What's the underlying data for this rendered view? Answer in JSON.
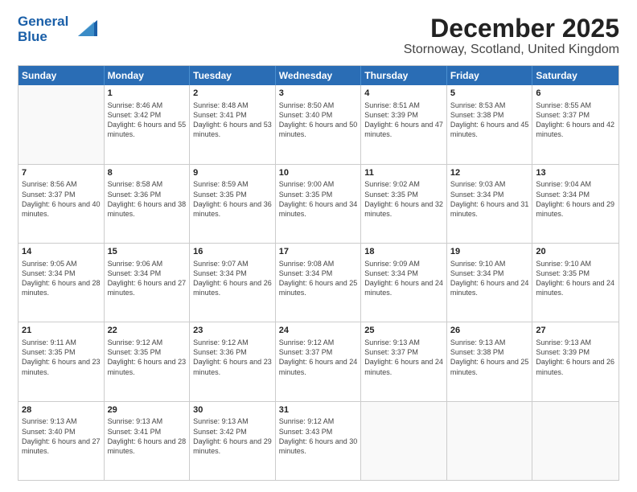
{
  "logo": {
    "line1": "General",
    "line2": "Blue"
  },
  "title": "December 2025",
  "subtitle": "Stornoway, Scotland, United Kingdom",
  "days": [
    "Sunday",
    "Monday",
    "Tuesday",
    "Wednesday",
    "Thursday",
    "Friday",
    "Saturday"
  ],
  "rows": [
    [
      {
        "day": "",
        "sunrise": "",
        "sunset": "",
        "daylight": ""
      },
      {
        "day": "1",
        "sunrise": "Sunrise: 8:46 AM",
        "sunset": "Sunset: 3:42 PM",
        "daylight": "Daylight: 6 hours and 55 minutes."
      },
      {
        "day": "2",
        "sunrise": "Sunrise: 8:48 AM",
        "sunset": "Sunset: 3:41 PM",
        "daylight": "Daylight: 6 hours and 53 minutes."
      },
      {
        "day": "3",
        "sunrise": "Sunrise: 8:50 AM",
        "sunset": "Sunset: 3:40 PM",
        "daylight": "Daylight: 6 hours and 50 minutes."
      },
      {
        "day": "4",
        "sunrise": "Sunrise: 8:51 AM",
        "sunset": "Sunset: 3:39 PM",
        "daylight": "Daylight: 6 hours and 47 minutes."
      },
      {
        "day": "5",
        "sunrise": "Sunrise: 8:53 AM",
        "sunset": "Sunset: 3:38 PM",
        "daylight": "Daylight: 6 hours and 45 minutes."
      },
      {
        "day": "6",
        "sunrise": "Sunrise: 8:55 AM",
        "sunset": "Sunset: 3:37 PM",
        "daylight": "Daylight: 6 hours and 42 minutes."
      }
    ],
    [
      {
        "day": "7",
        "sunrise": "Sunrise: 8:56 AM",
        "sunset": "Sunset: 3:37 PM",
        "daylight": "Daylight: 6 hours and 40 minutes."
      },
      {
        "day": "8",
        "sunrise": "Sunrise: 8:58 AM",
        "sunset": "Sunset: 3:36 PM",
        "daylight": "Daylight: 6 hours and 38 minutes."
      },
      {
        "day": "9",
        "sunrise": "Sunrise: 8:59 AM",
        "sunset": "Sunset: 3:35 PM",
        "daylight": "Daylight: 6 hours and 36 minutes."
      },
      {
        "day": "10",
        "sunrise": "Sunrise: 9:00 AM",
        "sunset": "Sunset: 3:35 PM",
        "daylight": "Daylight: 6 hours and 34 minutes."
      },
      {
        "day": "11",
        "sunrise": "Sunrise: 9:02 AM",
        "sunset": "Sunset: 3:35 PM",
        "daylight": "Daylight: 6 hours and 32 minutes."
      },
      {
        "day": "12",
        "sunrise": "Sunrise: 9:03 AM",
        "sunset": "Sunset: 3:34 PM",
        "daylight": "Daylight: 6 hours and 31 minutes."
      },
      {
        "day": "13",
        "sunrise": "Sunrise: 9:04 AM",
        "sunset": "Sunset: 3:34 PM",
        "daylight": "Daylight: 6 hours and 29 minutes."
      }
    ],
    [
      {
        "day": "14",
        "sunrise": "Sunrise: 9:05 AM",
        "sunset": "Sunset: 3:34 PM",
        "daylight": "Daylight: 6 hours and 28 minutes."
      },
      {
        "day": "15",
        "sunrise": "Sunrise: 9:06 AM",
        "sunset": "Sunset: 3:34 PM",
        "daylight": "Daylight: 6 hours and 27 minutes."
      },
      {
        "day": "16",
        "sunrise": "Sunrise: 9:07 AM",
        "sunset": "Sunset: 3:34 PM",
        "daylight": "Daylight: 6 hours and 26 minutes."
      },
      {
        "day": "17",
        "sunrise": "Sunrise: 9:08 AM",
        "sunset": "Sunset: 3:34 PM",
        "daylight": "Daylight: 6 hours and 25 minutes."
      },
      {
        "day": "18",
        "sunrise": "Sunrise: 9:09 AM",
        "sunset": "Sunset: 3:34 PM",
        "daylight": "Daylight: 6 hours and 24 minutes."
      },
      {
        "day": "19",
        "sunrise": "Sunrise: 9:10 AM",
        "sunset": "Sunset: 3:34 PM",
        "daylight": "Daylight: 6 hours and 24 minutes."
      },
      {
        "day": "20",
        "sunrise": "Sunrise: 9:10 AM",
        "sunset": "Sunset: 3:35 PM",
        "daylight": "Daylight: 6 hours and 24 minutes."
      }
    ],
    [
      {
        "day": "21",
        "sunrise": "Sunrise: 9:11 AM",
        "sunset": "Sunset: 3:35 PM",
        "daylight": "Daylight: 6 hours and 23 minutes."
      },
      {
        "day": "22",
        "sunrise": "Sunrise: 9:12 AM",
        "sunset": "Sunset: 3:35 PM",
        "daylight": "Daylight: 6 hours and 23 minutes."
      },
      {
        "day": "23",
        "sunrise": "Sunrise: 9:12 AM",
        "sunset": "Sunset: 3:36 PM",
        "daylight": "Daylight: 6 hours and 23 minutes."
      },
      {
        "day": "24",
        "sunrise": "Sunrise: 9:12 AM",
        "sunset": "Sunset: 3:37 PM",
        "daylight": "Daylight: 6 hours and 24 minutes."
      },
      {
        "day": "25",
        "sunrise": "Sunrise: 9:13 AM",
        "sunset": "Sunset: 3:37 PM",
        "daylight": "Daylight: 6 hours and 24 minutes."
      },
      {
        "day": "26",
        "sunrise": "Sunrise: 9:13 AM",
        "sunset": "Sunset: 3:38 PM",
        "daylight": "Daylight: 6 hours and 25 minutes."
      },
      {
        "day": "27",
        "sunrise": "Sunrise: 9:13 AM",
        "sunset": "Sunset: 3:39 PM",
        "daylight": "Daylight: 6 hours and 26 minutes."
      }
    ],
    [
      {
        "day": "28",
        "sunrise": "Sunrise: 9:13 AM",
        "sunset": "Sunset: 3:40 PM",
        "daylight": "Daylight: 6 hours and 27 minutes."
      },
      {
        "day": "29",
        "sunrise": "Sunrise: 9:13 AM",
        "sunset": "Sunset: 3:41 PM",
        "daylight": "Daylight: 6 hours and 28 minutes."
      },
      {
        "day": "30",
        "sunrise": "Sunrise: 9:13 AM",
        "sunset": "Sunset: 3:42 PM",
        "daylight": "Daylight: 6 hours and 29 minutes."
      },
      {
        "day": "31",
        "sunrise": "Sunrise: 9:12 AM",
        "sunset": "Sunset: 3:43 PM",
        "daylight": "Daylight: 6 hours and 30 minutes."
      },
      {
        "day": "",
        "sunrise": "",
        "sunset": "",
        "daylight": ""
      },
      {
        "day": "",
        "sunrise": "",
        "sunset": "",
        "daylight": ""
      },
      {
        "day": "",
        "sunrise": "",
        "sunset": "",
        "daylight": ""
      }
    ]
  ]
}
